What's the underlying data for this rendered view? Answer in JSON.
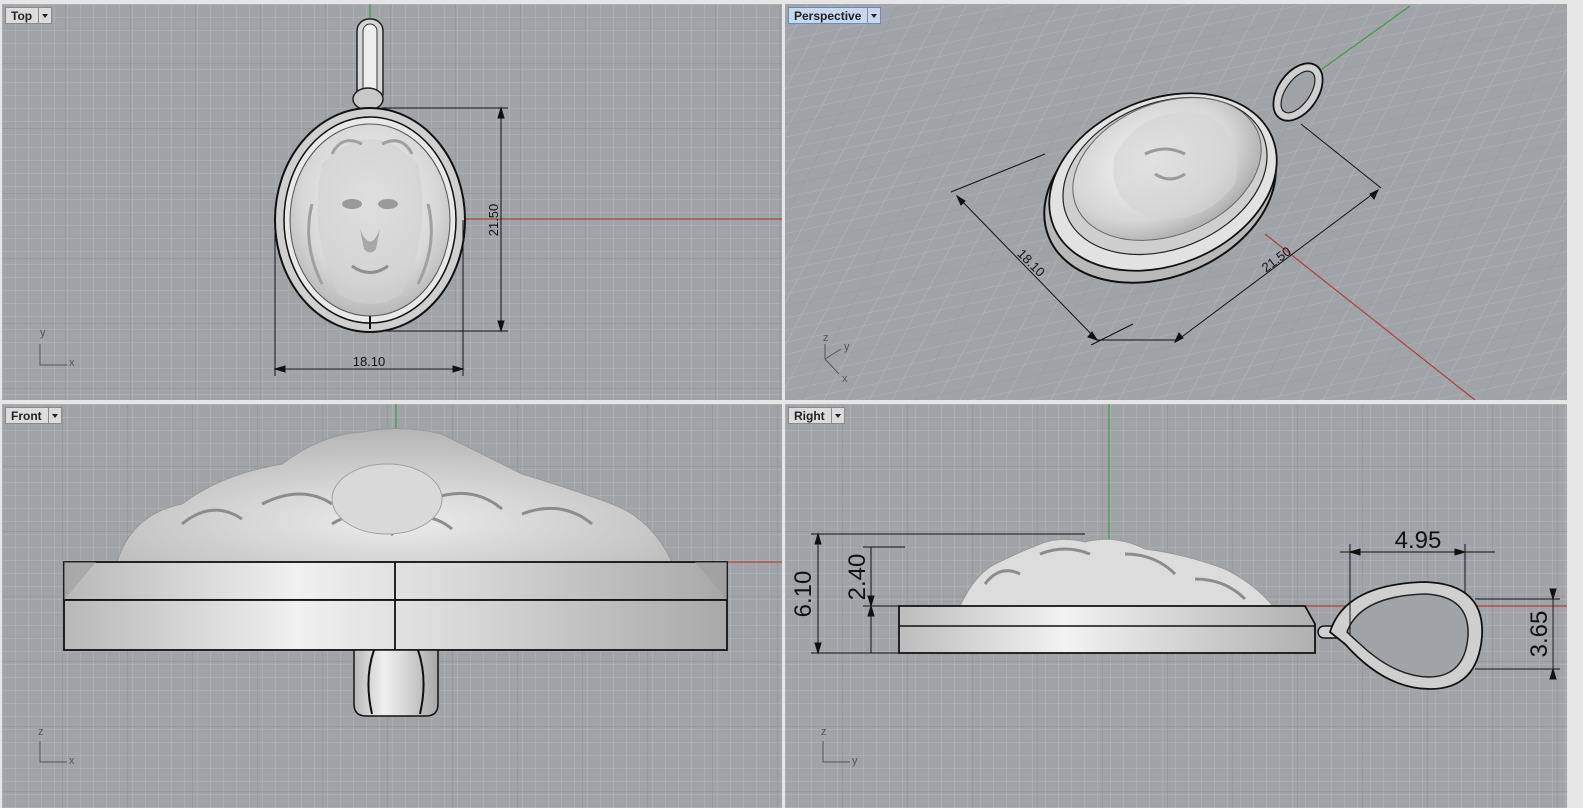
{
  "viewports": {
    "top": {
      "title": "Top",
      "dim_width": "18.10",
      "dim_height": "21.50",
      "axis_y": "y",
      "axis_x": "x"
    },
    "perspective": {
      "title": "Perspective",
      "dim_width": "18.10",
      "dim_height": "21.50",
      "axis_z": "z",
      "axis_y": "y",
      "axis_x": "x"
    },
    "front": {
      "title": "Front",
      "axis_z": "z",
      "axis_x": "x"
    },
    "right": {
      "title": "Right",
      "dim_total_height": "6.10",
      "dim_relief": "2.40",
      "dim_bail_width": "4.95",
      "dim_bail_height": "3.65",
      "axis_z": "z",
      "axis_y": "y"
    }
  },
  "colors": {
    "background": "#a0a4a8",
    "grid_minor": "#b2b6ba",
    "grid_major": "#8f9397",
    "x_axis": "#b0403a",
    "y_axis": "#3aa040",
    "active_tab": "#c7d7ee"
  },
  "icons": {
    "tab_menu": "chevron-down-icon"
  }
}
